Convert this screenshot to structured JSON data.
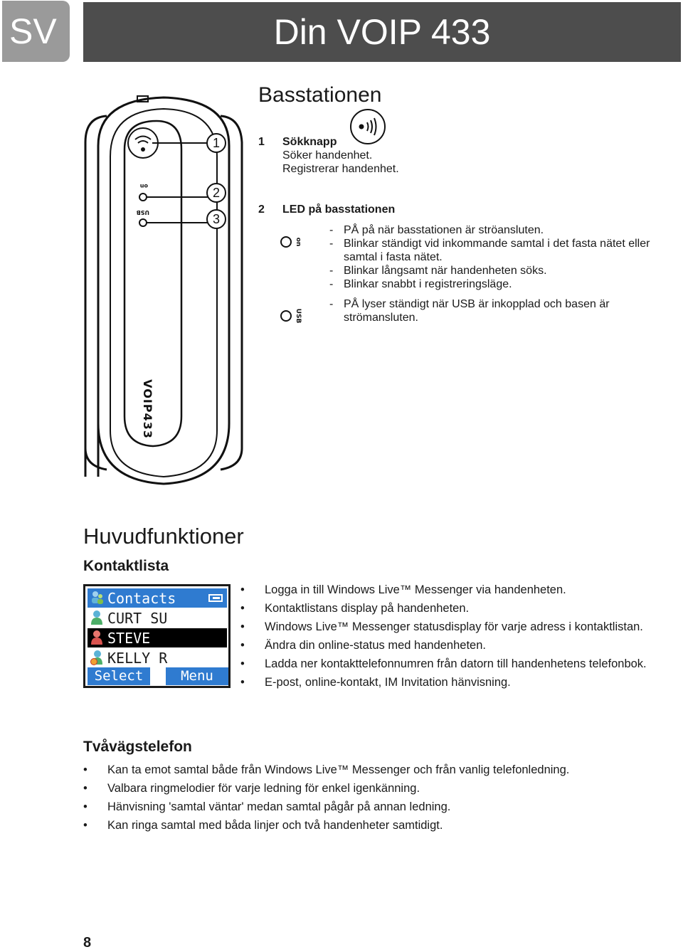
{
  "header": {
    "language_tab": "SV",
    "title": "Din VOIP 433"
  },
  "device_diagram": {
    "callouts": [
      "1",
      "2",
      "3"
    ],
    "led_labels": [
      "on",
      "USB"
    ],
    "brand_text": "VOIP433",
    "icons": [
      "paging-signal-icon",
      "led-on-indicator",
      "led-usb-indicator"
    ]
  },
  "basstationen": {
    "title": "Basstationen",
    "items": [
      {
        "number": "1",
        "title": "Sökknapp",
        "icon": "paging-button-icon",
        "lines": [
          "Söker handenhet.",
          "Registrerar handenhet."
        ]
      },
      {
        "number": "2",
        "title": "LED på basstationen",
        "groups": [
          {
            "led_label": "on",
            "points": [
              "PÅ på när basstationen är ströansluten.",
              "Blinkar ständigt vid inkommande samtal i det fasta nätet eller samtal i fasta nätet.",
              "Blinkar långsamt när handenheten söks.",
              "Blinkar snabbt i registreringsläge."
            ]
          },
          {
            "led_label": "USB",
            "points": [
              "PÅ lyser ständigt när USB är inkopplad och basen är strömansluten."
            ]
          }
        ],
        "dash": "-"
      }
    ]
  },
  "huvudfunktioner": {
    "title": "Huvudfunktioner",
    "kontaktlista": {
      "title": "Kontaktlista",
      "screen": {
        "header": "Contacts",
        "contacts": [
          {
            "name": "CURT SU",
            "status": "online",
            "selected": false
          },
          {
            "name": "STEVE",
            "status": "busy",
            "selected": true
          },
          {
            "name": "KELLY R",
            "status": "away",
            "selected": false
          }
        ],
        "softkeys": {
          "left": "Select",
          "right": "Menu"
        },
        "colors": {
          "bar": "#2f7bd0",
          "selection": "#000000"
        }
      },
      "bullets": [
        "Logga in till Windows Live™ Messenger via handenheten.",
        "Kontaktlistans display på handenheten.",
        "Windows Live™ Messenger statusdisplay för varje adress i kontaktlistan.",
        "Ändra din online-status med handenheten.",
        "Ladda ner kontakttelefonnumren från datorn till handenhetens telefonbok.",
        "E-post, online-kontakt, IM Invitation hänvisning."
      ]
    },
    "tvavagstelefon": {
      "title": "Tvåvägstelefon",
      "bullets": [
        "Kan ta emot samtal både från Windows Live™ Messenger och från vanlig telefonledning.",
        "Valbara ringmelodier för varje ledning för enkel igenkänning.",
        "Hänvisning 'samtal väntar' medan samtal pågår på annan ledning.",
        "Kan ringa samtal med båda linjer och två handenheter samtidigt."
      ]
    },
    "bullet_char": "•"
  },
  "footer": {
    "page_number": "8"
  }
}
